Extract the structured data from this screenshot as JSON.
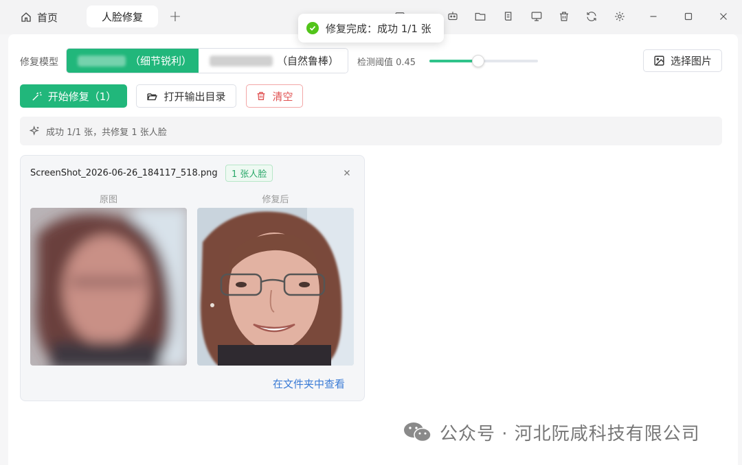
{
  "titlebar": {
    "home_tab": "首页",
    "active_tab": "人脸修复",
    "add_tab": "+"
  },
  "toast": {
    "message": "修复完成：成功 1/1 张"
  },
  "settings": {
    "model_label": "修复模型",
    "model_options": [
      {
        "suffix": "（细节锐利）",
        "selected": true
      },
      {
        "suffix": "（自然鲁棒）",
        "selected": false
      }
    ],
    "threshold_label": "检测阈值 0.45",
    "threshold_value": 0.45,
    "pick_image_label": "选择图片"
  },
  "actions": {
    "start_label": "开始修复（1）",
    "open_output_label": "打开输出目录",
    "clear_label": "清空"
  },
  "status": {
    "text": "成功 1/1 张，共修复 1 张人脸"
  },
  "result_card": {
    "filename": "ScreenShot_2026-06-26_184117_518.png",
    "face_badge": "1 张人脸",
    "original_caption": "原图",
    "restored_caption": "修复后",
    "view_in_folder": "在文件夹中查看"
  },
  "watermark": {
    "text": "公众号 · 河北阮咸科技有限公司"
  },
  "colors": {
    "accent": "#21b77b",
    "danger": "#e05252",
    "link": "#3a7bd5",
    "success": "#52c41a"
  }
}
